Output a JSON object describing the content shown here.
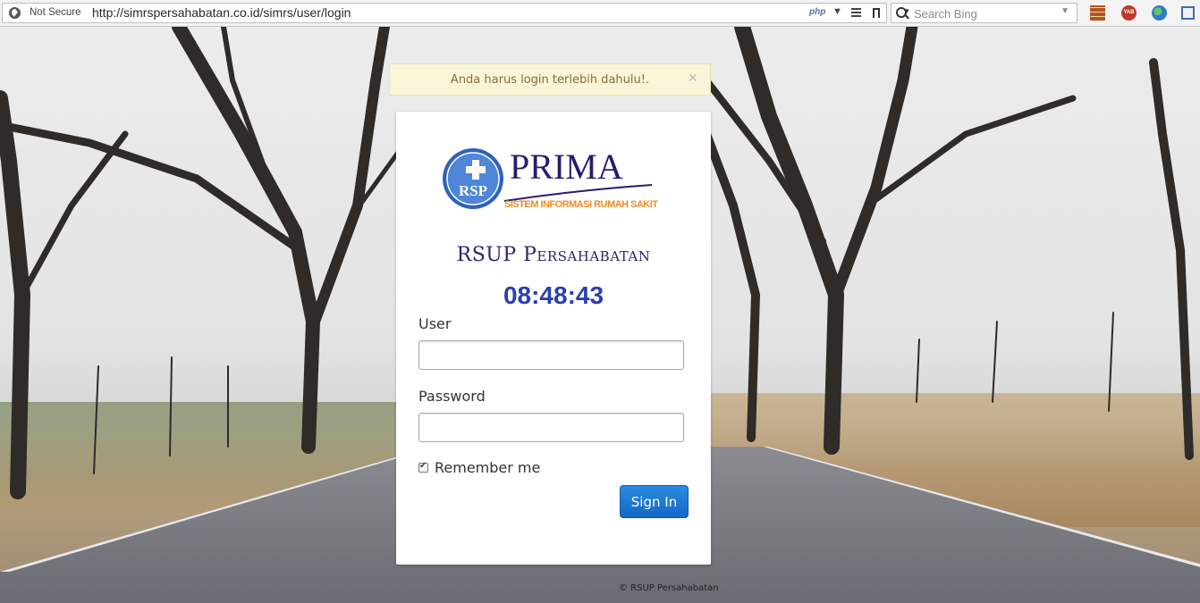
{
  "browser": {
    "security_label": "Not Secure",
    "url": "http://simrspersahabatan.co.id/simrs/user/login",
    "php_badge": "php",
    "search_placeholder": "Search Bing",
    "extensions": [
      "bricks-icon",
      "yab-icon",
      "earth-icon",
      "crop-icon"
    ],
    "yab_label": "YAB"
  },
  "alert": {
    "message": "Anda harus login terlebih dahulu!.",
    "close_glyph": "×"
  },
  "login": {
    "logo_text": "PRIMA",
    "logo_badge": "RSP",
    "logo_tagline": "SISTEM INFORMASI RUMAH SAKIT",
    "hospital_name": "RSUP Persahabatan",
    "clock": "08:48:43",
    "user_label": "User",
    "user_value": "",
    "password_label": "Password",
    "password_value": "",
    "remember_label": "Remember me",
    "remember_checked": true,
    "signin_label": "Sign In"
  },
  "footer": {
    "text": "© RSUP Persahabatan"
  },
  "colors": {
    "accent": "#1e75d1",
    "clock": "#2a3fb0",
    "title": "#2a2470",
    "alert_bg": "#faf5d8",
    "alert_text": "#8a6d3b",
    "logo_orange": "#f08a24"
  }
}
